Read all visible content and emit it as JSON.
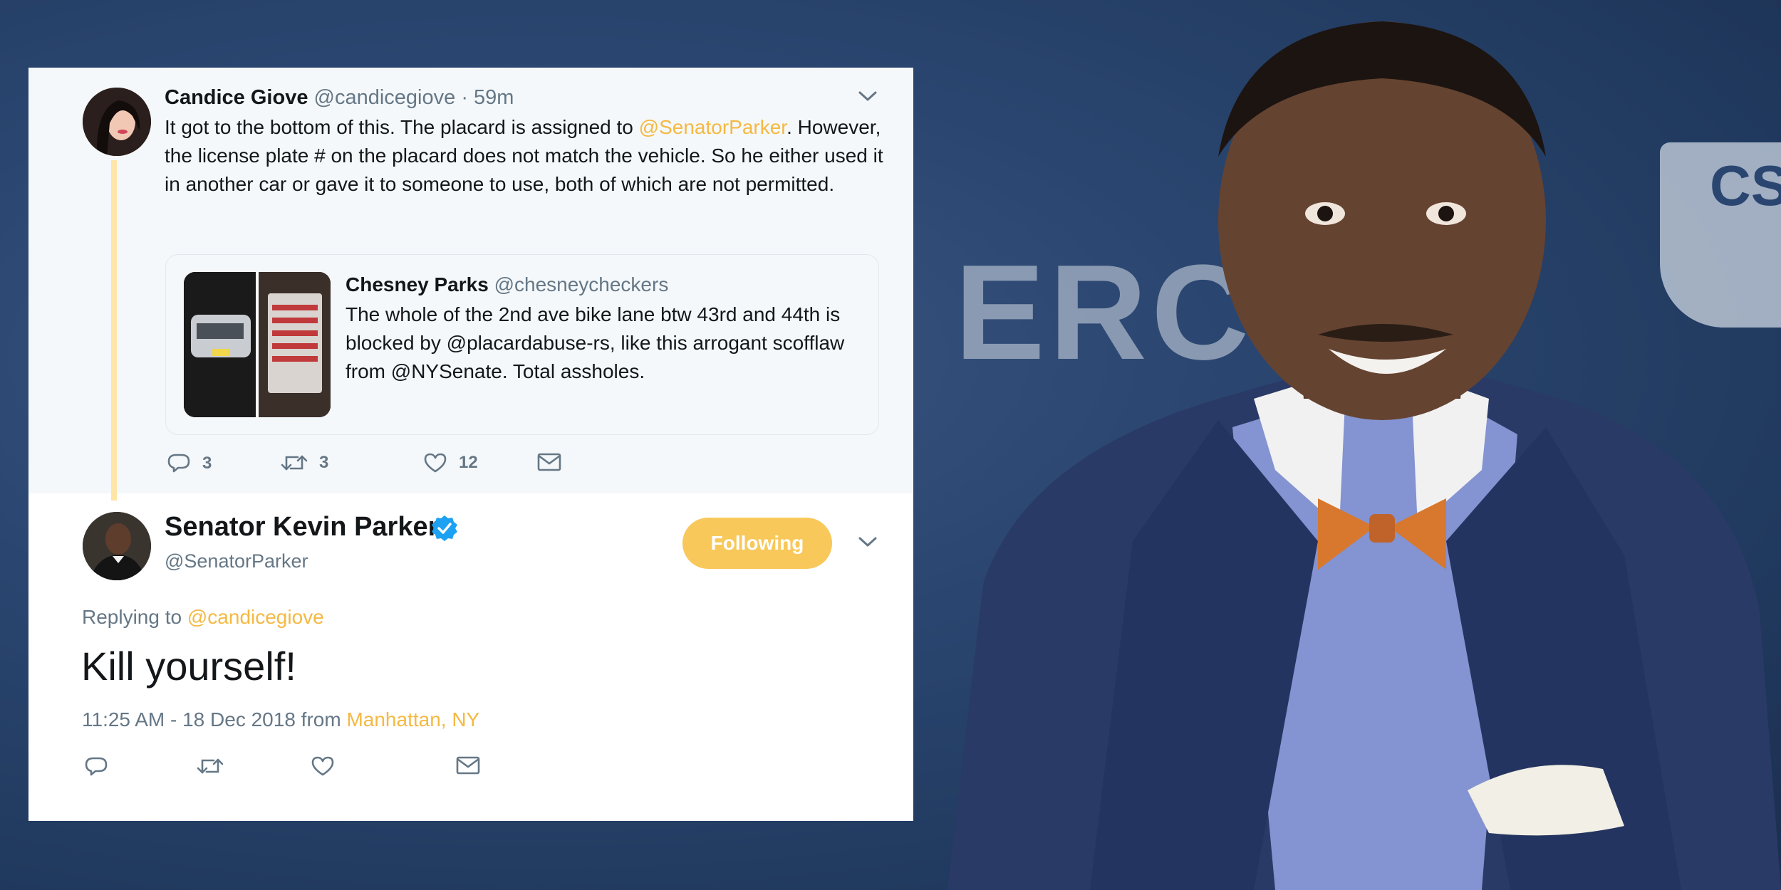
{
  "quoted_parent": {
    "author_name": "Candice Giove",
    "author_handle": "@candicegiove",
    "time": "· 59m",
    "text_before_mention": "It got to the bottom of this. The placard  is assigned to ",
    "mention": "@SenatorParker",
    "text_after_mention": ". However, the license plate # on the placard does not match the vehicle. So he either used it in another car or gave it to someone to use, both of which are not permitted.",
    "quoted_tweet": {
      "author_name": "Chesney Parks",
      "author_handle": "@chesneycheckers",
      "text": "The whole of the 2nd ave bike lane btw 43rd and 44th is blocked by @placardabuse-rs, like this arrogant scofflaw from @NYSenate. Total assholes."
    },
    "actions": {
      "reply_count": "3",
      "retweet_count": "3",
      "like_count": "12"
    }
  },
  "reply": {
    "author_name": "Senator Kevin Parker",
    "author_handle": "@SenatorParker",
    "follow_button_label": "Following",
    "replying_to_label": "Replying to",
    "replying_to_handle": "@candicegiove",
    "text": "Kill yourself!",
    "timestamp": "11:25 AM - 18 Dec 2018 from",
    "location": "Manhattan, NY"
  },
  "background": {
    "logo_text": "ERC",
    "logo_right_text": "CSC"
  },
  "colors": {
    "accent": "#f4b942",
    "follow_button": "#f8c85a",
    "verified": "#1da1f2",
    "thread_line": "#ffe5a6",
    "muted_text": "#657786",
    "background": "#233a5e"
  }
}
